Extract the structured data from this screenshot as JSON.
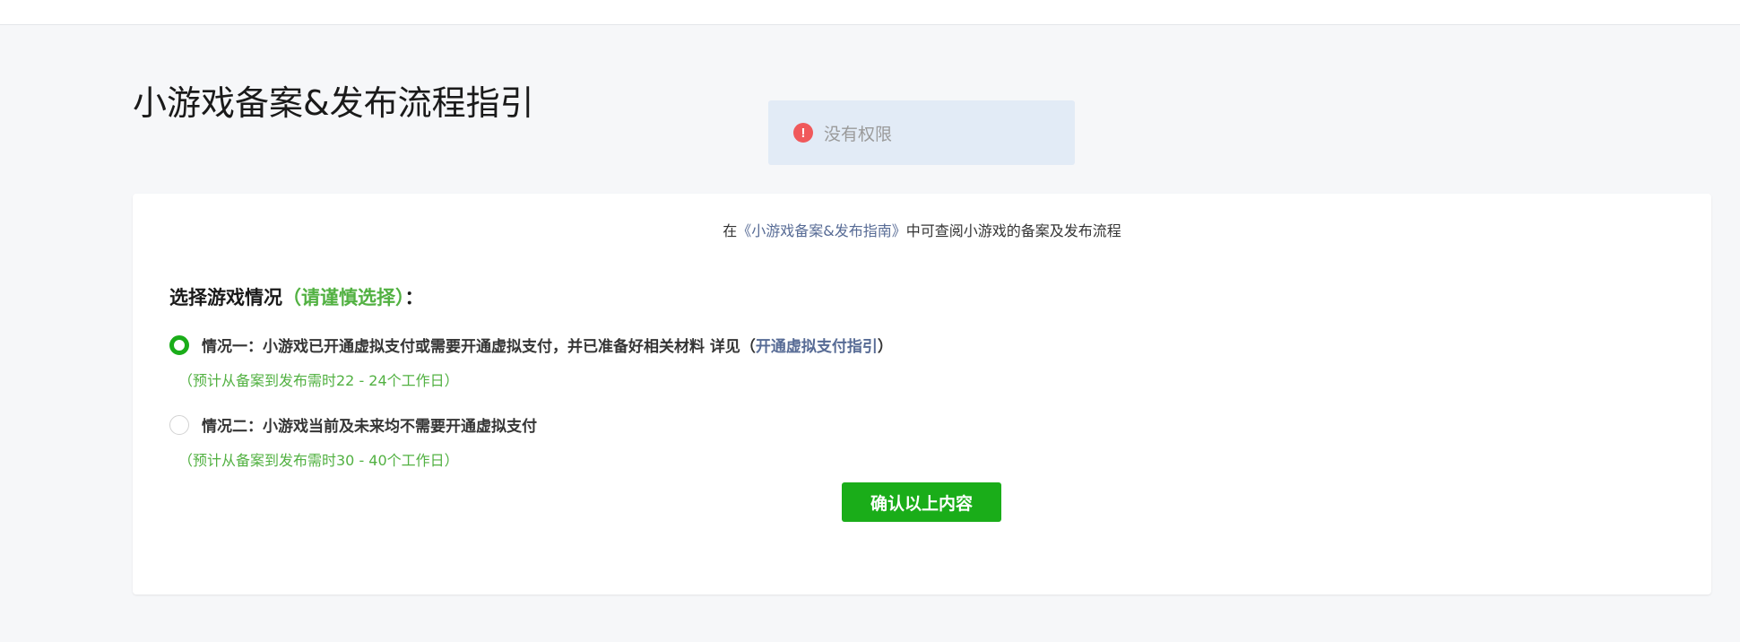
{
  "page": {
    "title": "小游戏备案&发布流程指引"
  },
  "toast": {
    "icon": "exclamation-icon",
    "text": "没有权限",
    "color": "#f0595b"
  },
  "card": {
    "intro_prefix": "在",
    "intro_link": "《小游戏备案&发布指南》",
    "intro_suffix": "中可查阅小游戏的备案及发布流程",
    "heading": "选择游戏情况",
    "heading_warning": "（请谨慎选择）",
    "heading_colon": "：",
    "options": [
      {
        "label": "情况一：小游戏已开通虚拟支付或需要开通虚拟支付，并已准备好相关材料 详见（",
        "link": "开通虚拟支付指引",
        "label_suffix": "）",
        "note": "（预计从备案到发布需时22 - 24个工作日）",
        "selected": true
      },
      {
        "label": "情况二：小游戏当前及未来均不需要开通虚拟支付",
        "note": "（预计从备案到发布需时30 - 40个工作日）",
        "selected": false
      }
    ],
    "confirm_label": "确认以上内容"
  },
  "colors": {
    "primary_green": "#1aad19",
    "note_green": "#52b142",
    "link_blue": "#576b95",
    "toast_bg": "#e2ebf6"
  }
}
